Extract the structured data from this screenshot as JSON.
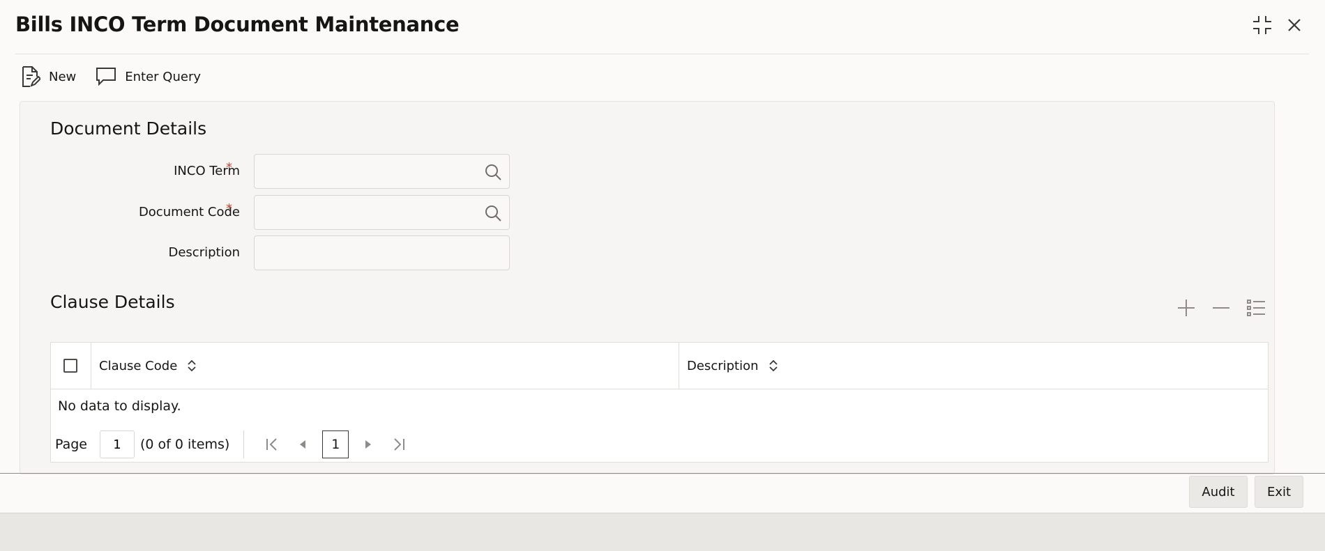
{
  "window": {
    "title": "Bills INCO Term Document Maintenance",
    "restore_icon": "collapse-icon",
    "close_icon": "close-icon"
  },
  "toolbar": {
    "new_label": "New",
    "enter_query_label": "Enter Query"
  },
  "document_details": {
    "section_title": "Document Details",
    "inco_term": {
      "label": "INCO Term",
      "required": "*",
      "value": ""
    },
    "document_code": {
      "label": "Document Code",
      "required": "*",
      "value": ""
    },
    "description": {
      "label": "Description",
      "value": ""
    }
  },
  "clause_details": {
    "section_title": "Clause Details",
    "columns": [
      "Clause Code",
      "Description"
    ],
    "rows": [],
    "empty_message": "No data to display.",
    "pager": {
      "page_label": "Page",
      "page_value": "1",
      "items_text": "(0 of 0 items)",
      "current_page": "1"
    }
  },
  "footer": {
    "audit_label": "Audit",
    "exit_label": "Exit"
  },
  "colors": {
    "required": "#c74634",
    "text": "#161513",
    "panel_bg": "#f6f5f3"
  }
}
